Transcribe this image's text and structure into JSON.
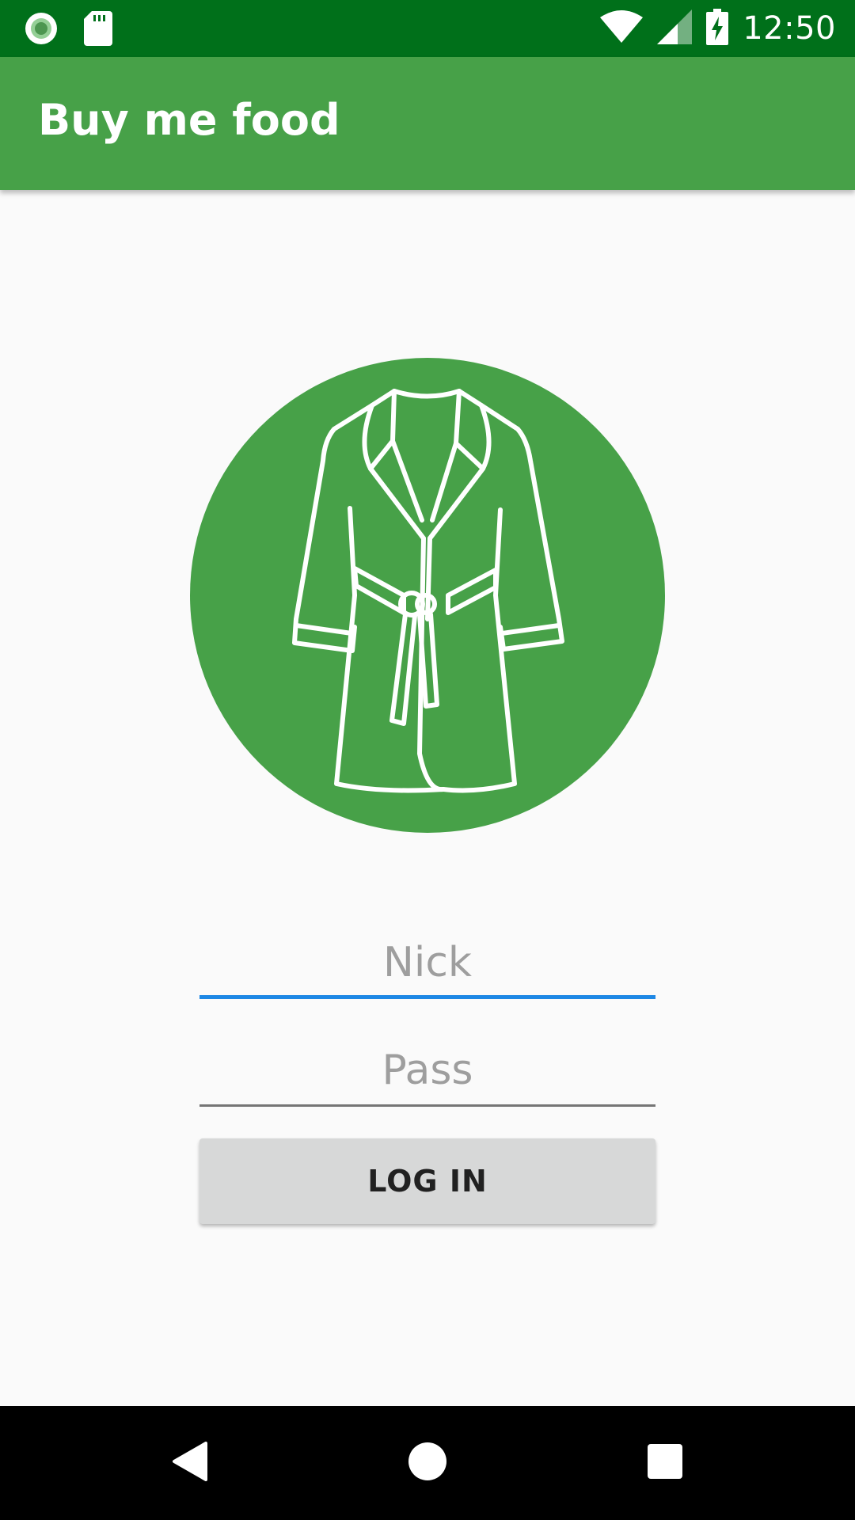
{
  "status_bar": {
    "time": "12:50",
    "icons": [
      "record-icon",
      "sd-card-icon",
      "wifi-icon",
      "cell-signal-icon",
      "battery-charging-icon"
    ]
  },
  "app_bar": {
    "title": "Buy me food"
  },
  "logo": {
    "icon": "bathrobe-icon",
    "circle_color": "#47a148"
  },
  "form": {
    "nick_placeholder": "Nick",
    "nick_value": "",
    "pass_placeholder": "Pass",
    "pass_value": "",
    "login_label": "LOG IN"
  },
  "nav_bar": {
    "icons": [
      "back-icon",
      "home-icon",
      "recents-icon"
    ]
  },
  "colors": {
    "status_bar": "#00701a",
    "app_bar": "#47a148",
    "focus_underline": "#1e88e5",
    "button": "#d7d8d8"
  }
}
